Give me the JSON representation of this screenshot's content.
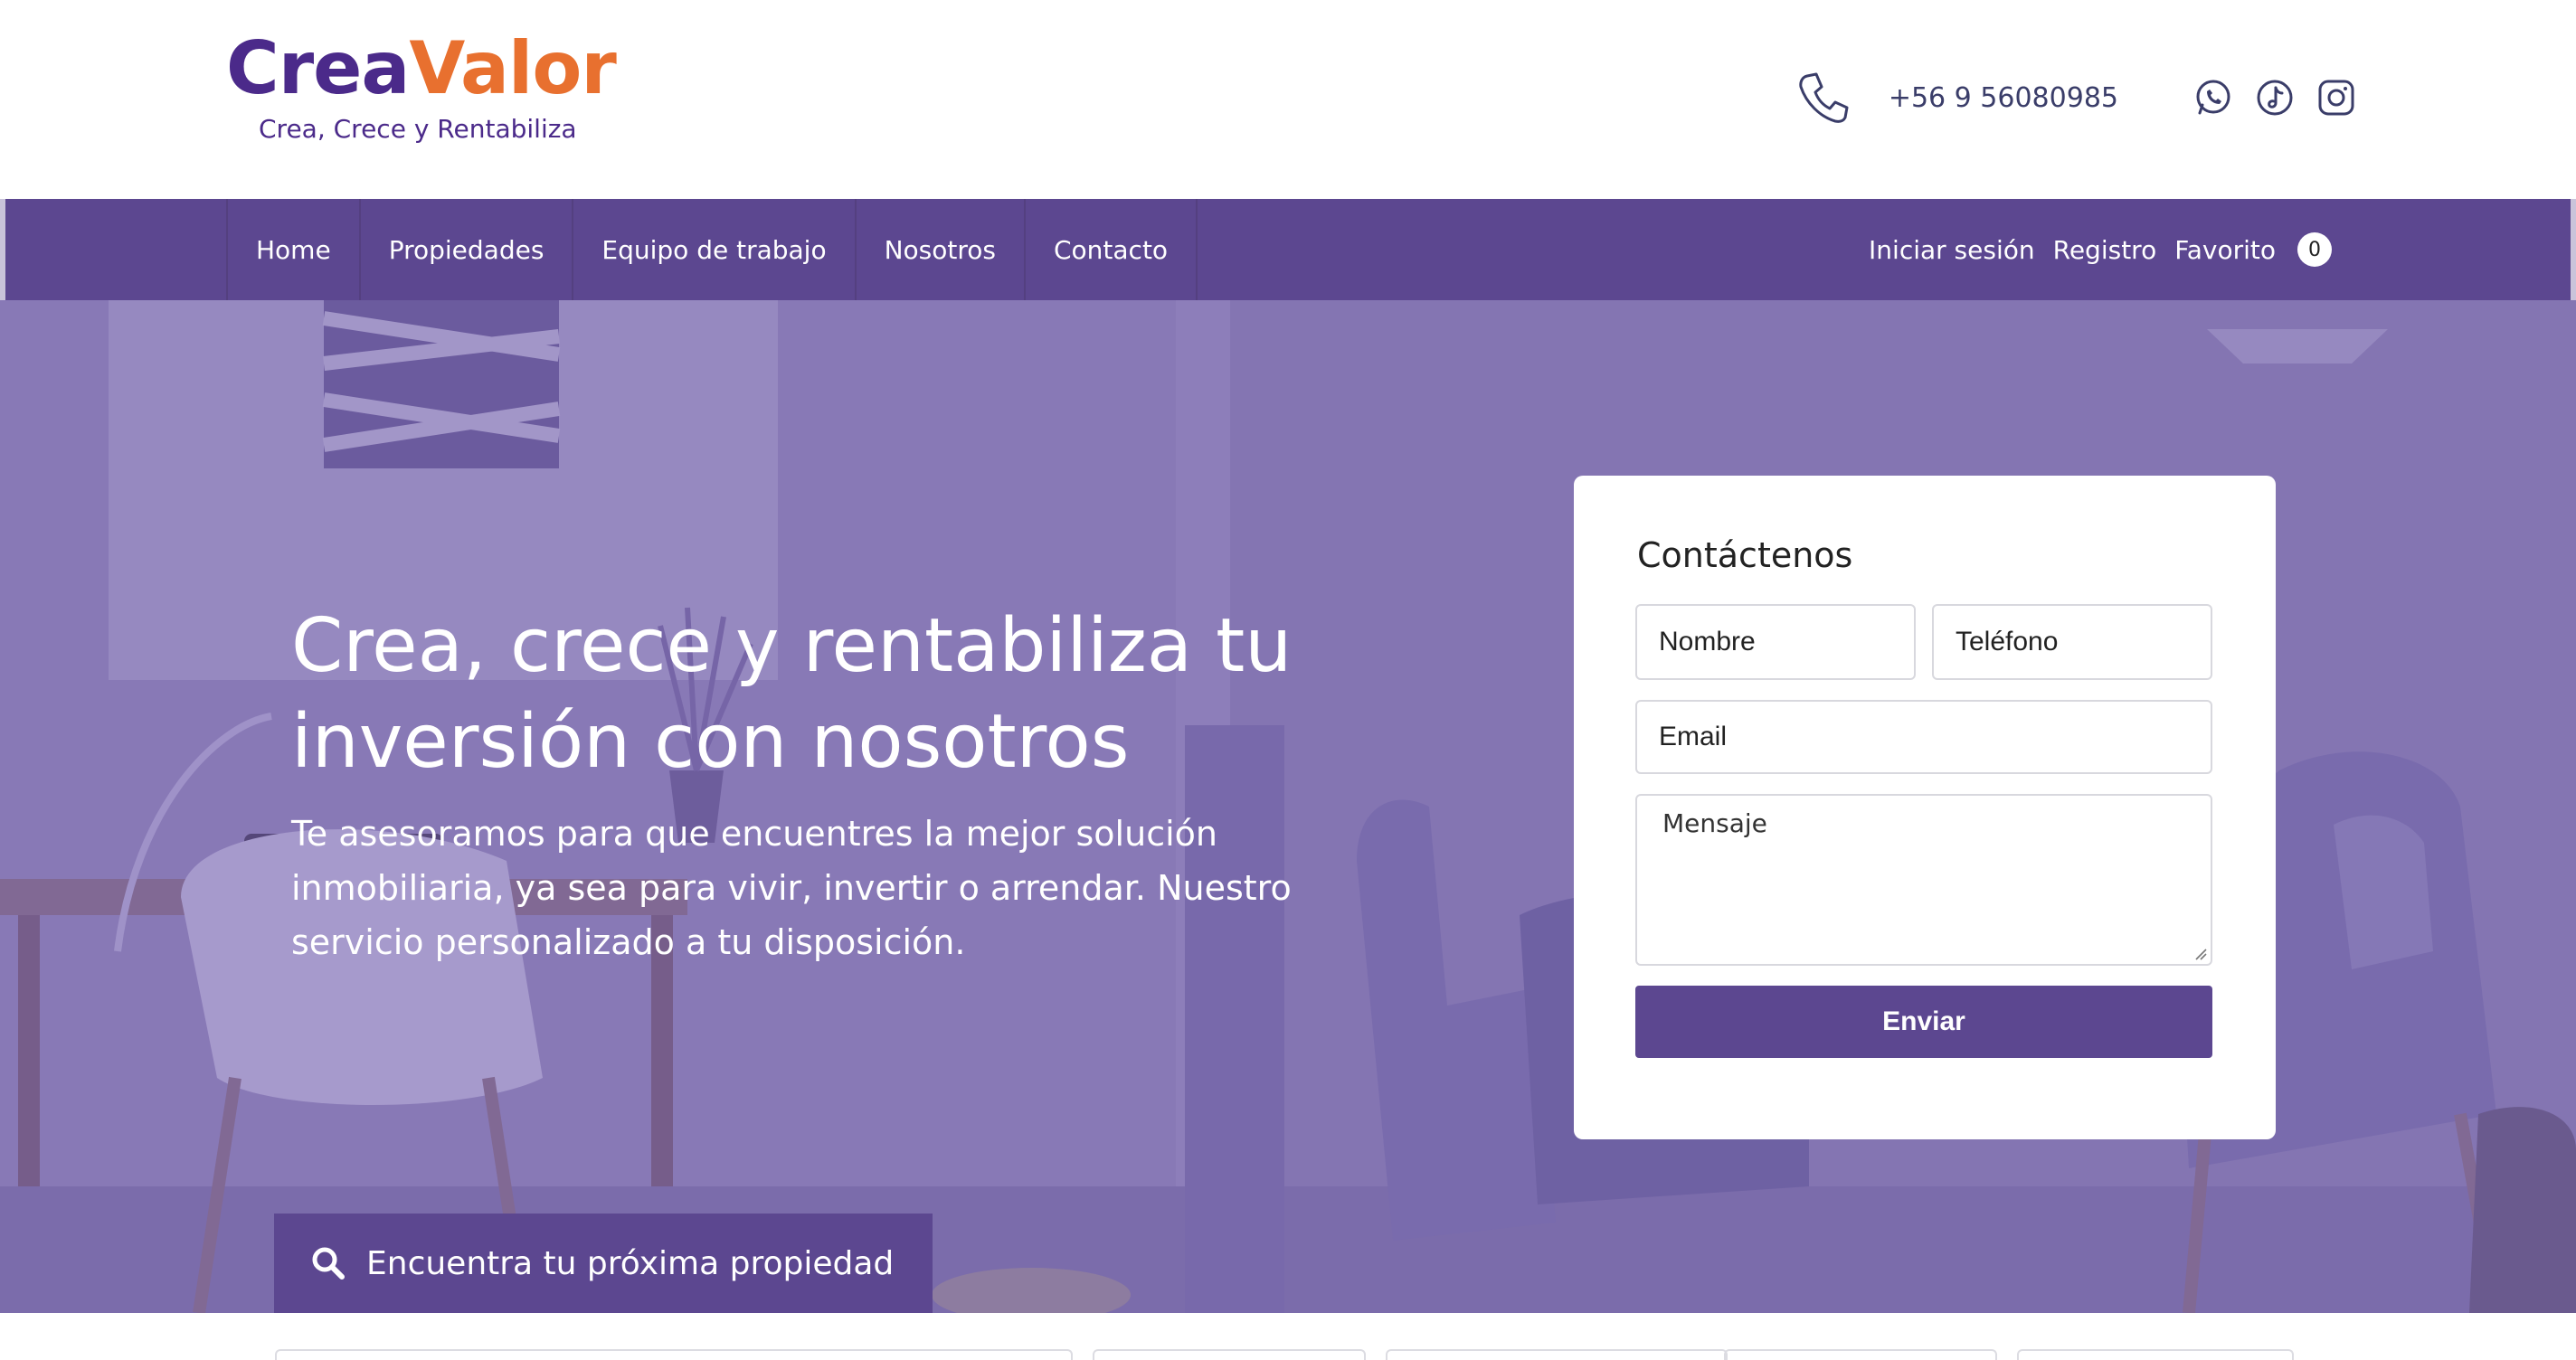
{
  "header": {
    "logo": {
      "part1": "Crea",
      "part2": "Valor",
      "tagline": "Crea, Crece y Rentabiliza"
    },
    "phone": "+56 9 56080985",
    "social_icons": [
      "whatsapp-icon",
      "tiktok-icon",
      "instagram-icon"
    ]
  },
  "nav": {
    "items": [
      {
        "label": "Home"
      },
      {
        "label": "Propiedades"
      },
      {
        "label": "Equipo de trabajo"
      },
      {
        "label": "Nosotros"
      },
      {
        "label": "Contacto"
      }
    ],
    "login": "Iniciar sesión",
    "register": "Registro",
    "favorites": "Favorito",
    "favorites_count": "0"
  },
  "hero": {
    "title": "Crea, crece y rentabiliza tu inversión con nosotros",
    "subtitle": "Te asesoramos para que encuentres la mejor solución inmobiliaria, ya sea para vivir, invertir o arrendar. Nuestro servicio personalizado a tu disposición.",
    "search_button": "Encuentra tu próxima propiedad"
  },
  "form": {
    "title": "Contáctenos",
    "name_placeholder": "Nombre",
    "phone_placeholder": "Teléfono",
    "email_placeholder": "Email",
    "message_placeholder": "Mensaje",
    "submit": "Enviar"
  },
  "colors": {
    "brand_purple": "#5c4790",
    "logo_purple": "#4b2a8a",
    "logo_orange": "#e8702f",
    "hero_overlay": "#8a7bb4"
  }
}
